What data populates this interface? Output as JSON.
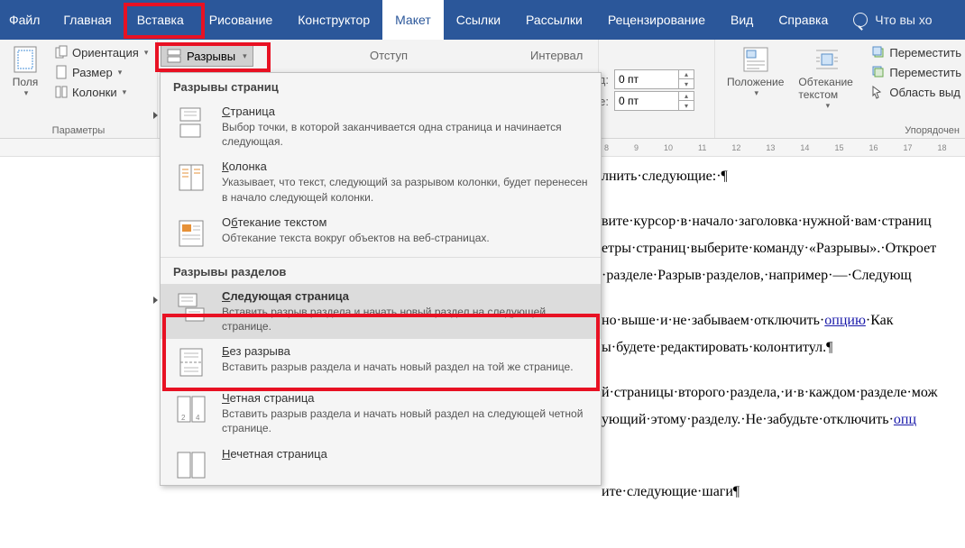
{
  "tabs": {
    "file": "Файл",
    "home": "Главная",
    "insert": "Вставка",
    "draw": "Рисование",
    "design": "Конструктор",
    "layout": "Макет",
    "references": "Ссылки",
    "mailings": "Рассылки",
    "review": "Рецензирование",
    "view": "Вид",
    "help": "Справка",
    "tellme": "Что вы хо"
  },
  "ribbon": {
    "margins": "Поля",
    "orientation": "Ориентация",
    "size": "Размер",
    "columns": "Колонки",
    "breaks": "Разрывы",
    "params_label": "Параметры",
    "indent_label": "Отступ",
    "spacing_label": "Интервал",
    "spacing_before_val": "0 пт",
    "spacing_after_val": "0 пт",
    "spacing_before_pref": "д:",
    "spacing_after_pref": "е:",
    "position": "Положение",
    "wrap": "Обтекание текстом",
    "bring_forward": "Переместить",
    "send_backward": "Переместить",
    "selection_pane": "Область выд",
    "arrange_label": "Упорядочен"
  },
  "dropdown": {
    "section_pages": "Разрывы страниц",
    "section_sections": "Разрывы разделов",
    "items": [
      {
        "title": "Страница",
        "title_u": "С",
        "desc": "Выбор точки, в которой заканчивается одна страница и начинается следующая."
      },
      {
        "title": "Колонка",
        "title_u": "К",
        "desc": "Указывает, что текст, следующий за разрывом колонки, будет перенесен в начало следующей колонки."
      },
      {
        "title": "Обтекание текстом",
        "title_u": "б",
        "title_pre": "О",
        "desc": "Обтекание текста вокруг объектов на веб-страницах."
      },
      {
        "title": "Следующая страница",
        "title_u": "С",
        "desc": "Вставить разрыв раздела и начать новый раздел на следующей странице."
      },
      {
        "title": "Без разрыва",
        "title_u": "Б",
        "desc": "Вставить разрыв раздела и начать новый раздел на той же странице."
      },
      {
        "title": "Четная страница",
        "title_u": "Ч",
        "desc": "Вставить разрыв раздела и начать новый раздел на следующей четной странице."
      },
      {
        "title": "Нечетная страница",
        "title_u": "Н",
        "desc": ""
      }
    ]
  },
  "document": {
    "p1": "лнить·следующие:·¶",
    "p2": "вите·курсор·в·начало·заголовка·нужной·вам·страниц",
    "p3": "етры·страниц·выберите·команду·«Разрывы».·Откроет",
    "p4": "·разделе·Разрыв·разделов,·например·—·Следующ",
    "p5": "но·выше·и·не·забываем·отключить·",
    "p5b": "·Как",
    "p6": "ы·будете·редактировать·колонтитул.¶",
    "p7": "й·страницы·второго·раздела,·и·в·каждом·разделе·мож",
    "p8": "ующий·этому·разделу.·Не·забудьте·отключить·",
    "p9": "ите·следующие·шаги¶",
    "link_opt": "опцию",
    "link_opt2": "опц"
  },
  "ruler_ticks": [
    "8",
    "9",
    "10",
    "11",
    "12",
    "13",
    "14",
    "15",
    "16",
    "17",
    "18"
  ]
}
